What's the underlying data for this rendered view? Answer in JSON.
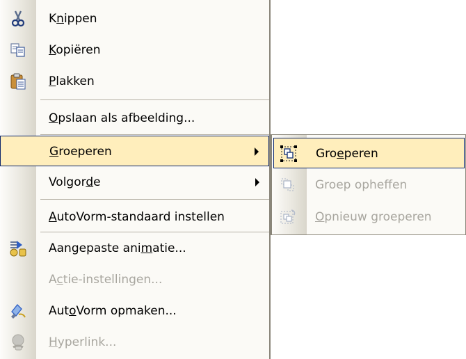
{
  "menu": {
    "items": [
      {
        "label_pre": "K",
        "label_acc": "n",
        "label_post": "ippen",
        "icon": "scissors-icon",
        "disabled": false
      },
      {
        "label_pre": "",
        "label_acc": "K",
        "label_post": "opiëren",
        "icon": "copy-icon",
        "disabled": false
      },
      {
        "label_pre": "",
        "label_acc": "P",
        "label_post": "lakken",
        "icon": "paste-icon",
        "disabled": false
      },
      {
        "label_pre": "",
        "label_acc": "O",
        "label_post": "pslaan als afbeelding...",
        "icon": "",
        "disabled": false
      },
      {
        "label_pre": "",
        "label_acc": "G",
        "label_post": "roeperen",
        "icon": "",
        "disabled": false,
        "submenu": true,
        "active": true
      },
      {
        "label_pre": "Volgor",
        "label_acc": "d",
        "label_post": "e",
        "icon": "",
        "disabled": false,
        "submenu": true
      },
      {
        "label_pre": "",
        "label_acc": "A",
        "label_post": "utoVorm-standaard instellen",
        "icon": "",
        "disabled": false
      },
      {
        "label_pre": "Aangepaste ani",
        "label_acc": "m",
        "label_post": "atie...",
        "icon": "custom-animation-icon",
        "disabled": false
      },
      {
        "label_pre": "A",
        "label_acc": "c",
        "label_post": "tie-instellingen...",
        "icon": "",
        "disabled": true
      },
      {
        "label_pre": "Aut",
        "label_acc": "o",
        "label_post": "Vorm opmaken...",
        "icon": "format-autoshape-icon",
        "disabled": false
      },
      {
        "label_pre": "",
        "label_acc": "H",
        "label_post": "yperlink...",
        "icon": "hyperlink-icon",
        "disabled": true
      }
    ]
  },
  "submenu": {
    "items": [
      {
        "label_pre": "Gro",
        "label_acc": "e",
        "label_post": "peren",
        "icon": "group-icon",
        "disabled": false,
        "active": true
      },
      {
        "label_pre": "Groep opheffen",
        "label_acc": "",
        "label_post": "",
        "icon": "ungroup-icon",
        "disabled": true
      },
      {
        "label_pre": "",
        "label_acc": "O",
        "label_post": "pnieuw groeperen",
        "icon": "regroup-icon",
        "disabled": true
      }
    ]
  }
}
